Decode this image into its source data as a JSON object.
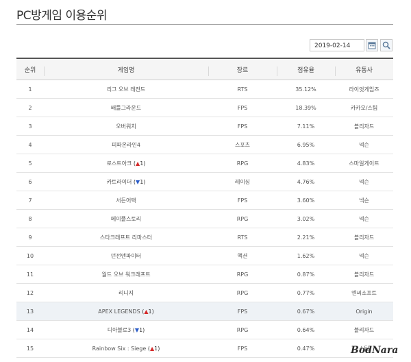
{
  "page": {
    "title": "PC방게임 이용순위"
  },
  "filter": {
    "date": "2019-02-14"
  },
  "table": {
    "headers": [
      "순위",
      "게임명",
      "장르",
      "점유율",
      "유통사"
    ],
    "rows": [
      {
        "rank": "1",
        "name": "리그 오브 레전드",
        "genre": "RTS",
        "share": "35.12%",
        "publisher": "라이엇게임즈"
      },
      {
        "rank": "2",
        "name": "배틀그라운드",
        "genre": "FPS",
        "share": "18.39%",
        "publisher": "카카오/스팀"
      },
      {
        "rank": "3",
        "name": "오버워치",
        "genre": "FPS",
        "share": "7.11%",
        "publisher": "블리자드"
      },
      {
        "rank": "4",
        "name": "피파온라인4",
        "genre": "스포츠",
        "share": "6.95%",
        "publisher": "넥슨"
      },
      {
        "rank": "5",
        "name": "로스트아크",
        "change_dir": "up",
        "change_num": "1",
        "genre": "RPG",
        "share": "4.83%",
        "publisher": "스마일게이트"
      },
      {
        "rank": "6",
        "name": "카트라이더",
        "change_dir": "down",
        "change_num": "1",
        "genre": "레이싱",
        "share": "4.76%",
        "publisher": "넥슨"
      },
      {
        "rank": "7",
        "name": "서든어택",
        "genre": "FPS",
        "share": "3.60%",
        "publisher": "넥슨"
      },
      {
        "rank": "8",
        "name": "메이플스토리",
        "genre": "RPG",
        "share": "3.02%",
        "publisher": "넥슨"
      },
      {
        "rank": "9",
        "name": "스타크래프트 리마스터",
        "genre": "RTS",
        "share": "2.21%",
        "publisher": "블리자드"
      },
      {
        "rank": "10",
        "name": "던전앤파이터",
        "genre": "액션",
        "share": "1.62%",
        "publisher": "넥슨"
      },
      {
        "rank": "11",
        "name": "월드 오브 워크래프트",
        "genre": "RPG",
        "share": "0.87%",
        "publisher": "블리자드"
      },
      {
        "rank": "12",
        "name": "리니지",
        "genre": "RPG",
        "share": "0.77%",
        "publisher": "엔씨소프트"
      },
      {
        "rank": "13",
        "name": "APEX LEGENDS",
        "change_dir": "up",
        "change_num": "1",
        "genre": "FPS",
        "share": "0.67%",
        "publisher": "Origin",
        "highlight": true
      },
      {
        "rank": "14",
        "name": "디아블로3",
        "change_dir": "down",
        "change_num": "1",
        "genre": "RPG",
        "share": "0.64%",
        "publisher": "블리자드"
      },
      {
        "rank": "15",
        "name": "Rainbow Six : Siege",
        "change_dir": "up",
        "change_num": "1",
        "genre": "FPS",
        "share": "0.47%",
        "publisher": "스팀"
      }
    ]
  },
  "watermark": "BodNara",
  "icons": {
    "calendar": "calendar-icon",
    "search": "search-icon",
    "up": "arrow-up-icon",
    "down": "arrow-down-icon"
  },
  "colors": {
    "up": "#d42a2a",
    "down": "#2a5cc9",
    "highlight_row": "#eef2f6"
  }
}
